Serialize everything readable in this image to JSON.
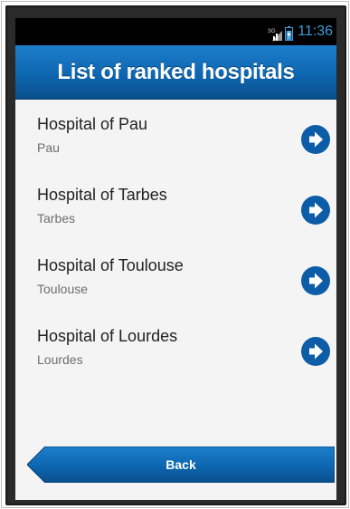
{
  "status_bar": {
    "network_label": "3G",
    "time": "11:36",
    "time_color": "#3a9bd9"
  },
  "header": {
    "title": "List of ranked hospitals",
    "color": "#0d66b0"
  },
  "hospitals": [
    {
      "name": "Hospital of Pau",
      "city": "Pau",
      "icon": "arrow-right-circle-icon"
    },
    {
      "name": "Hospital of Tarbes",
      "city": "Tarbes",
      "icon": "arrow-right-circle-icon"
    },
    {
      "name": "Hospital of Toulouse",
      "city": "Toulouse",
      "icon": "arrow-right-circle-icon"
    },
    {
      "name": "Hospital of Lourdes",
      "city": "Lourdes",
      "icon": "arrow-right-circle-icon"
    }
  ],
  "footer": {
    "back_label": "Back"
  }
}
